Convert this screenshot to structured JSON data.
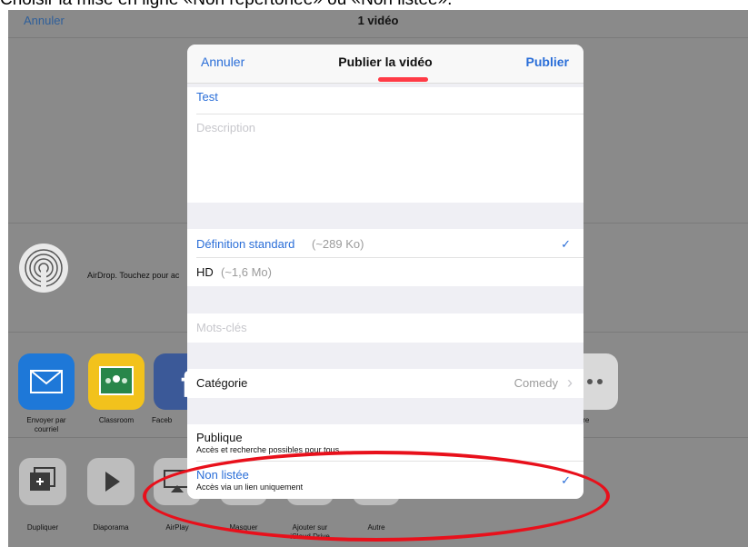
{
  "caption": "Choisir la mise en ligne «Non répertoriée» ou «Non listée».",
  "topbar": {
    "cancel": "Annuler",
    "title": "1 vidéo"
  },
  "airdrop": {
    "label": "AirDrop. Touchez pour ac",
    "icon": "airdrop-icon"
  },
  "apps": [
    {
      "label": "Envoyer par courriel",
      "icon": "mail-icon",
      "color": "#1e78d8"
    },
    {
      "label": "Classroom",
      "icon": "classroom-icon",
      "color": "#f2c21c"
    },
    {
      "label": "Faceb",
      "icon": "facebook-icon",
      "color": "#3b5998"
    },
    {
      "label": "tre",
      "icon": "more-icon",
      "color": "#d9d9d9"
    }
  ],
  "actions": [
    {
      "label": "Dupliquer",
      "icon": "duplicate-icon"
    },
    {
      "label": "Diaporama",
      "icon": "play-icon"
    },
    {
      "label": "AirPlay",
      "icon": "airplay-icon"
    },
    {
      "label": "Masquer",
      "icon": "hide-icon"
    },
    {
      "label": "Ajouter sur iCloud Drive",
      "icon": "icloud-icon"
    },
    {
      "label": "Autre",
      "icon": "more-icon"
    }
  ],
  "modal": {
    "cancel": "Annuler",
    "title": "Publier la vidéo",
    "publish": "Publier",
    "video_title": "Test",
    "description_placeholder": "Description",
    "quality": [
      {
        "name": "Définition standard",
        "size": "(~289 Ko)",
        "selected": true
      },
      {
        "name": "HD",
        "size": "(~1,6 Mo)",
        "selected": false
      }
    ],
    "keywords_placeholder": "Mots-clés",
    "category_label": "Catégorie",
    "category_value": "Comedy",
    "privacy": [
      {
        "name": "Publique",
        "desc": "Accès et recherche possibles pour tous",
        "selected": false
      },
      {
        "name": "Non listée",
        "desc": "Accès via un lien uniquement",
        "selected": true
      }
    ],
    "check_mark": "✓",
    "chevron": "›"
  },
  "colors": {
    "accent": "#2a6ed8",
    "highlight": "#e8101b"
  }
}
